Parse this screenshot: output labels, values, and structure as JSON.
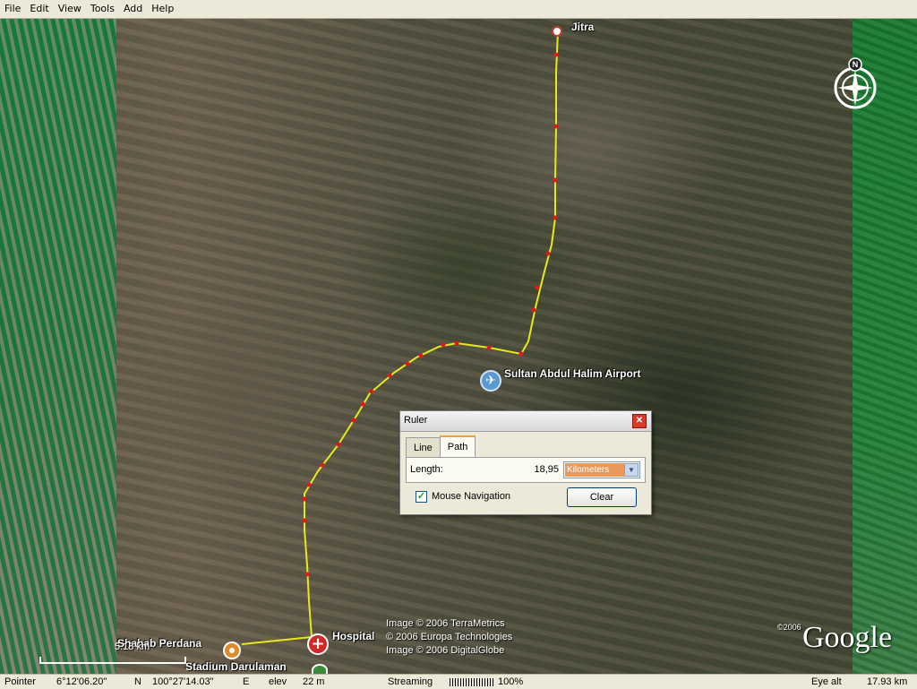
{
  "menu": [
    "File",
    "Edit",
    "View",
    "Tools",
    "Add",
    "Help"
  ],
  "map": {
    "places": {
      "jitra": "Jitra",
      "airport": "Sultan Abdul Halim Airport",
      "hospital": "Hospital",
      "shahab": "Shahab Perdana",
      "stadium": "Stadium Darulaman"
    },
    "copyright": [
      "Image © 2006 TerraMetrics",
      "© 2006 Europa Technologies",
      "Image © 2006 DigitalGlobe"
    ],
    "logo_year": "©2006",
    "logo": "Google",
    "scale": "5.18 km",
    "compass_north": "N",
    "route_color": "#e8e81e",
    "route_point_color": "#e01a1a"
  },
  "ruler": {
    "title": "Ruler",
    "tabs": [
      "Line",
      "Path"
    ],
    "active_tab": "Path",
    "length_label": "Length:",
    "length_value": "18,95",
    "unit": "Kilometers",
    "mouse_nav_label": "Mouse Navigation",
    "mouse_nav_checked": true,
    "clear_label": "Clear"
  },
  "status": {
    "pointer_label": "Pointer",
    "lat": "6°12'06.20\"",
    "lat_dir": "N",
    "lon": "100°27'14.03\"",
    "lon_dir": "E",
    "elev_label": "elev",
    "elev_value": "22 m",
    "streaming_label": "Streaming",
    "streaming_percent": "100%",
    "eye_alt_label": "Eye alt",
    "eye_alt_value": "17.93 km"
  }
}
